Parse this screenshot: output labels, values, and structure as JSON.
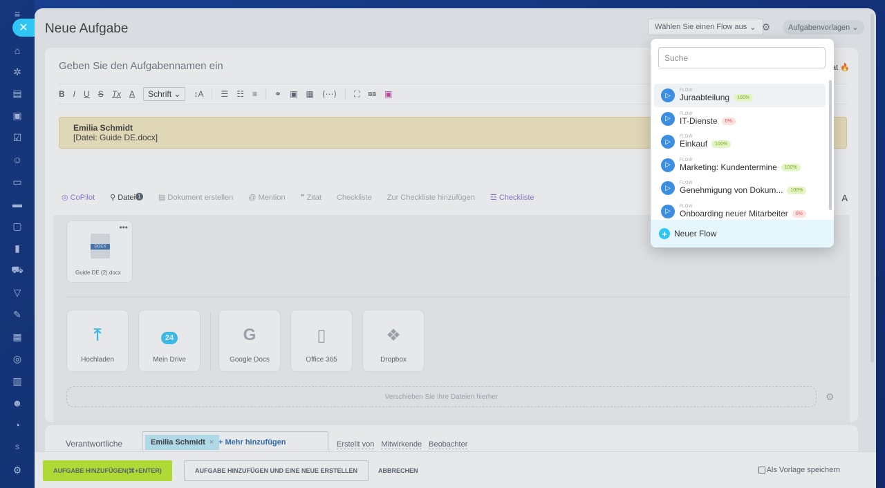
{
  "window": {
    "title": "Neue Aufgabe"
  },
  "header": {
    "flow_select": "Wählen Sie einen Flow aus",
    "templates": "Aufgabenvorlagen"
  },
  "task": {
    "name_placeholder": "Geben Sie den Aufgabennamen ein",
    "important_suffix": "at"
  },
  "toolbar": {
    "bold": "B",
    "italic": "I",
    "underline": "U",
    "strike": "S",
    "clear_format": "Tx",
    "text_color": "A",
    "font": "Schrift",
    "font_size": "↕A"
  },
  "quote": {
    "author": "Emilia Schmidt",
    "text": "[Datei: Guide DE.docx]"
  },
  "actions": {
    "copilot": "CoPilot",
    "file": "Datei",
    "file_count": "1",
    "document": "Dokument erstellen",
    "mention": "Mention",
    "quote": "Zitat",
    "checklist": "Checkliste",
    "add_to_checklist": "Zur Checkliste hinzufügen",
    "checklist2": "Checkliste",
    "right": "A"
  },
  "files": {
    "attached": {
      "name": "Guide DE (2).docx",
      "ext": "DOCX"
    },
    "sources": [
      {
        "label": "Hochladen",
        "icon": "upload-icon"
      },
      {
        "label": "Mein Drive",
        "icon": "cloud-icon"
      },
      {
        "label": "Google Docs",
        "icon": "google-icon"
      },
      {
        "label": "Office 365",
        "icon": "office-icon"
      },
      {
        "label": "Dropbox",
        "icon": "dropbox-icon"
      }
    ],
    "cloud_number": "24",
    "dropzone": "Verschieben Sie Ihre Dateien hierher"
  },
  "responsible": {
    "label": "Verantwortliche",
    "assignee": "Emilia Schmidt",
    "add_more": "+ Mehr hinzufügen",
    "links": [
      "Erstellt von",
      "Mitwirkende",
      "Beobachter"
    ]
  },
  "footer": {
    "add": "AUFGABE HINZUFÜGEN(⌘+ENTER)",
    "add_new": "AUFGABE HINZUFÜGEN UND EINE NEUE ERSTELLEN",
    "cancel": "ABBRECHEN",
    "save_template": "Als Vorlage speichern"
  },
  "popup": {
    "search_placeholder": "Suche",
    "flows": [
      {
        "kind": "FLOW",
        "name": "Juraabteilung",
        "badge": "100%",
        "status": "green"
      },
      {
        "kind": "FLOW",
        "name": "IT-Dienste",
        "badge": "0%",
        "status": "red"
      },
      {
        "kind": "FLOW",
        "name": "Einkauf",
        "badge": "100%",
        "status": "green"
      },
      {
        "kind": "FLOW",
        "name": "Marketing: Kundentermine",
        "badge": "100%",
        "status": "green"
      },
      {
        "kind": "FLOW",
        "name": "Genehmigung von Dokum...",
        "badge": "100%",
        "status": "green"
      },
      {
        "kind": "FLOW",
        "name": "Onboarding neuer Mitarbeiter",
        "badge": "0%",
        "status": "red"
      }
    ],
    "new_flow": "Neuer Flow"
  },
  "sidebar": {
    "user_initial": "S",
    "icons": [
      "menu-icon",
      "home-icon",
      "flow-icon",
      "document-icon",
      "chat-icon",
      "checkbox-icon",
      "group-icon",
      "file-icon",
      "card-icon",
      "monitor-icon",
      "analytics-icon",
      "cart-icon",
      "funnel-icon",
      "edit-icon",
      "message-icon",
      "target-icon",
      "calendar-icon",
      "robot-icon",
      "copilot-icon",
      "settings-icon"
    ]
  }
}
